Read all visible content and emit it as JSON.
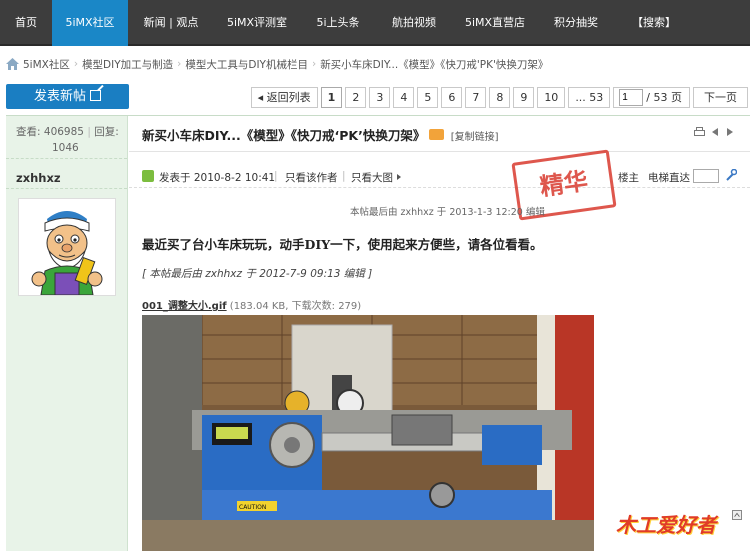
{
  "nav": {
    "items": [
      {
        "label": "首页",
        "active": false
      },
      {
        "label": "5iMX社区",
        "active": true
      },
      {
        "label": "新闻 | 观点",
        "active": false
      },
      {
        "label": "5iMX评测室",
        "active": false
      },
      {
        "label": "5i上头条",
        "active": false
      },
      {
        "label": "航拍视频",
        "active": false
      },
      {
        "label": "5iMX直营店",
        "active": false
      },
      {
        "label": "积分抽奖",
        "active": false
      },
      {
        "label": "【搜索】",
        "active": false
      }
    ]
  },
  "breadcrumb": {
    "items": [
      "5iMX社区",
      "模型DIY加工与制造",
      "模型大工具与DIY机械栏目",
      "新买小车床DIY...《模型》《快刀戒'PK'快换刀架》"
    ]
  },
  "toolbar": {
    "new_post": "发表新帖"
  },
  "pager": {
    "back": "◂ 返回列表",
    "pages": [
      "1",
      "2",
      "3",
      "4",
      "5",
      "6",
      "7",
      "8",
      "9",
      "10",
      "... 53"
    ],
    "current": "1",
    "input_value": "1",
    "total": "/ 53 页",
    "next": "下一页"
  },
  "stats": {
    "views_label": "查看:",
    "views": "406985",
    "replies_label": "回复:",
    "replies": "1046"
  },
  "author": {
    "name": "zxhhxz"
  },
  "post": {
    "title": "新买小车床DIY...《模型》《快刀戒‘PK’快换刀架》",
    "copy_link": "[复制链接]",
    "posted": "发表于 2010-8-2 10:41",
    "author_only": "只看该作者",
    "big_pic": "只看大图",
    "floor_owner": "楼主",
    "elevator": "电梯直达",
    "last_edit": "本帖最后由 zxhhxz 于 2013-1-3 12:20 编辑",
    "stamp": "精华",
    "body": "最近买了台小车床玩玩，动手DIY一下，使用起来方便些，请各位看看。",
    "edit_note": "[ 本帖最后由 zxhhxz 于 2012-7-9 09:13 编辑 ]",
    "attachment_name": "001_调整大小.gif",
    "attachment_info": "(183.04 KB, 下载次数: 279)",
    "photo_caution": "CAUTION"
  },
  "logo": {
    "text": "木工爱好者"
  },
  "colors": {
    "nav_bg": "#3d3d3d",
    "nav_active": "#1a87c7",
    "side_bg": "#e8f3e8",
    "stamp_red": "#d93a2e"
  }
}
